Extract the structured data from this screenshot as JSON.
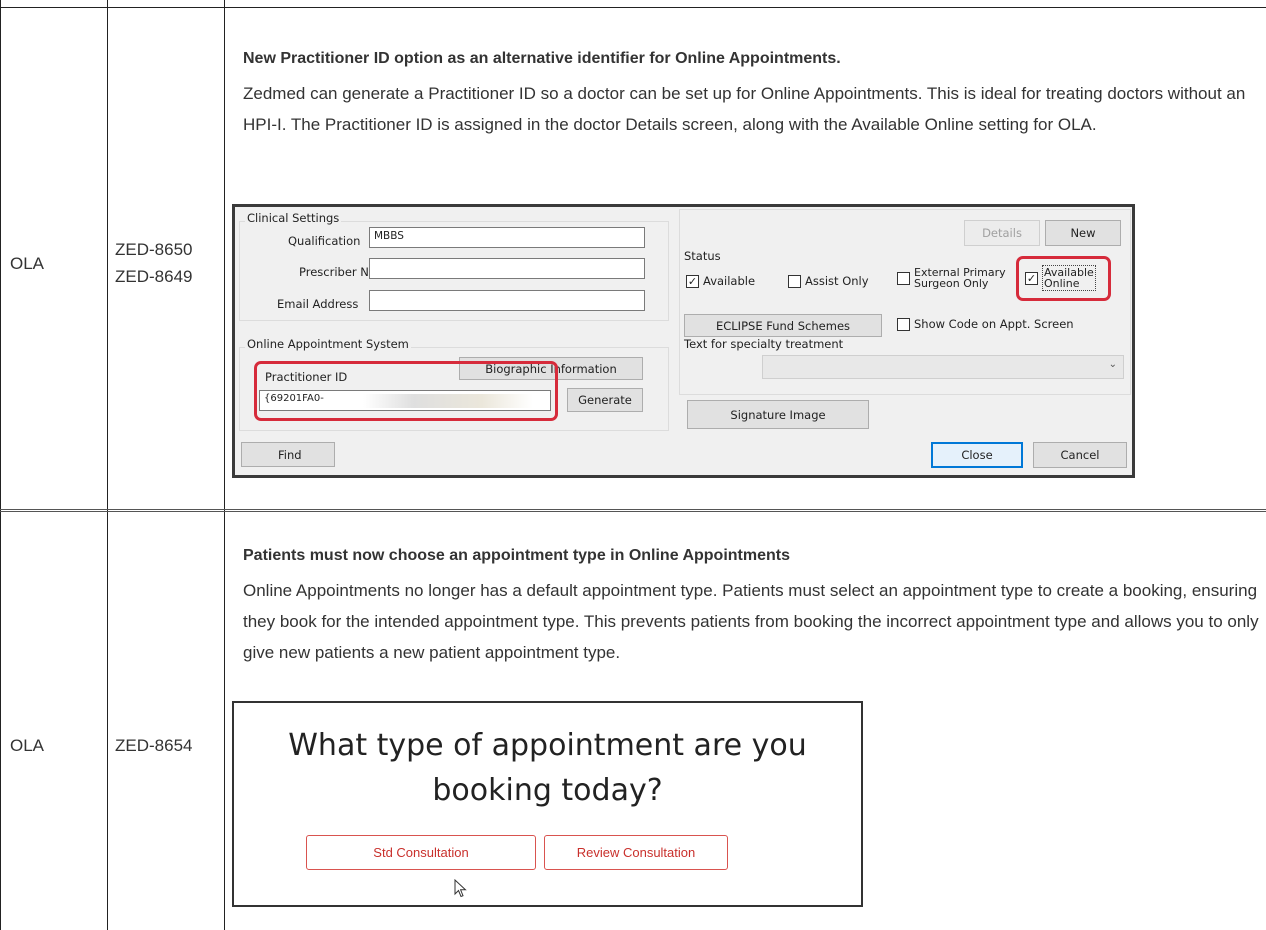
{
  "rows": [
    {
      "category": "OLA",
      "tickets": [
        "ZED-8650",
        "ZED-8649"
      ],
      "title": "New Practitioner ID option as an alternative identifier for Online Appointments.",
      "body": "Zedmed can generate a Practitioner ID so a doctor can be set up for Online Appointments. This is ideal for treating doctors without an HPI-I. The Practitioner ID is assigned in the doctor Details screen, along with the Available Online setting for OLA."
    },
    {
      "category": "OLA",
      "tickets": [
        "ZED-8654"
      ],
      "title": "Patients must now choose an appointment type in Online Appointments",
      "body": "Online Appointments no longer has a default appointment type. Patients must select an appointment type to create a booking,  ensuring they book for the intended appointment type. This prevents patients from booking the incorrect appointment type and allows you to only give new patients a new patient appointment type."
    }
  ],
  "dialog": {
    "clinical_settings": "Clinical Settings",
    "qualification_label": "Qualification",
    "qualification_value": "MBBS",
    "prescriber_label": "Prescriber No",
    "prescriber_value": "",
    "email_label": "Email Address",
    "email_value": "",
    "online_system": "Online Appointment System",
    "practitioner_id_label": "Practitioner ID",
    "practitioner_id_value": "{69201FA0-",
    "bio_button": "Biographic Information",
    "generate_button": "Generate",
    "find_button": "Find",
    "details_button": "Details",
    "new_button": "New",
    "status_label": "Status",
    "available": {
      "label": "Available",
      "checked": true
    },
    "assist_only": {
      "label": "Assist Only",
      "checked": false
    },
    "external_primary": {
      "label": "External Primary Surgeon Only",
      "line1": "External Primary",
      "line2": "Surgeon Only",
      "checked": false
    },
    "available_online": {
      "label": "Available Online",
      "line1": "Available",
      "line2": "Online",
      "checked": true
    },
    "eclipse_button": "ECLIPSE Fund Schemes",
    "show_code": {
      "label": "Show Code on Appt. Screen",
      "checked": false
    },
    "specialty_label": "Text for specialty treatment",
    "signature_button": "Signature Image",
    "close_button": "Close",
    "cancel_button": "Cancel",
    "highlight_color": "#d62b3b"
  },
  "booking": {
    "question": "What type of appointment are you booking today?",
    "question_line1": "What type of appointment are you",
    "question_line2": "booking today?",
    "options": [
      "Std Consultation",
      "Review Consultation"
    ],
    "accent_color": "#d9534f"
  }
}
